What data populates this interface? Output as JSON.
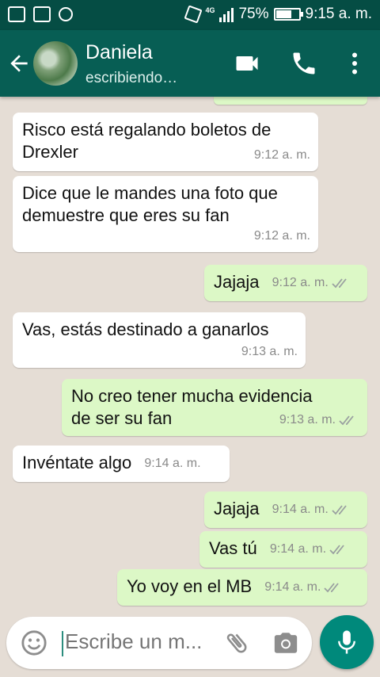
{
  "status_bar": {
    "network": "4G",
    "battery_text": "75%",
    "battery_level": 0.75,
    "time": "9:15 a. m."
  },
  "header": {
    "contact_name": "Daniela",
    "contact_status": "escribiendo…",
    "icons": [
      "back-arrow-icon",
      "video-call-icon",
      "phone-icon",
      "more-vert-icon"
    ],
    "bar_color": "#075e54"
  },
  "messages": [
    {
      "direction": "in",
      "lines": [
        "Risco está regalando boletos de",
        "Drexler"
      ],
      "time": "9:12 a. m."
    },
    {
      "direction": "in",
      "lines": [
        "Dice que le mandes una foto que",
        "demuestre que eres su fan"
      ],
      "time": "9:12 a. m."
    },
    {
      "direction": "out",
      "lines": [
        "Jajaja"
      ],
      "time": "9:12 a. m."
    },
    {
      "direction": "in",
      "lines": [
        "Vas, estás destinado a ganarlos"
      ],
      "time": "9:13 a. m."
    },
    {
      "direction": "out",
      "lines": [
        "No creo tener mucha evidencia",
        "de ser su fan"
      ],
      "time": "9:13 a. m."
    },
    {
      "direction": "in",
      "lines": [
        "Invéntate algo"
      ],
      "time": "9:14 a. m."
    },
    {
      "direction": "out",
      "lines": [
        "Jajaja"
      ],
      "time": "9:14 a. m."
    },
    {
      "direction": "out",
      "lines": [
        "Vas tú"
      ],
      "time": "9:14 a. m."
    },
    {
      "direction": "out",
      "lines": [
        "Yo voy en el MB"
      ],
      "time": "9:14 a. m."
    }
  ],
  "composer": {
    "placeholder": "Escribe un m...",
    "icons": [
      "emoji-icon",
      "attach-icon",
      "camera-icon",
      "mic-icon"
    ],
    "accent": "#00897b"
  },
  "colors": {
    "incoming_bubble": "#ffffff",
    "outgoing_bubble": "#dcf8c6",
    "chat_background": "#e5ddd5"
  }
}
